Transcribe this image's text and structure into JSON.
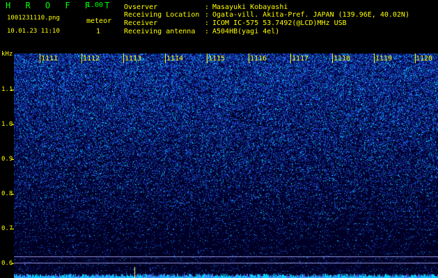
{
  "header": {
    "app_title": "H R O F F T",
    "version": "1.00",
    "file_name": "1001231110.png",
    "meteor_label": "meteor",
    "date_time": "10.01.23 11:10",
    "meteor_count": "1"
  },
  "station_info": [
    {
      "label": "Ovserver",
      "value": "Masayuki Kobayashi"
    },
    {
      "label": "Receiving Location",
      "value": "Ogata-vill. Akita-Pref. JAPAN (139.96E, 40.02N)"
    },
    {
      "label": "Receiver",
      "value": "ICOM IC-575 53.7492(@LCD)MHz USB"
    },
    {
      "label": "Receiving antenna",
      "value": "A504HB(yagi 4el)"
    }
  ],
  "colon": ":",
  "axis": {
    "y_unit_label": "kHz",
    "y_ticks": [
      "1.1",
      "1.0",
      "0.9",
      "0.8",
      "0.7",
      "0.6"
    ],
    "x_ticks": [
      "1111",
      "1112",
      "1113",
      "1114",
      "1115",
      "1116",
      "1117",
      "1118",
      "1119",
      "1120"
    ]
  },
  "colors": {
    "text": "#ffff00",
    "title": "#00ff00",
    "background": "#000000",
    "signal_low": "#000066",
    "signal_mid": "#1a2cff",
    "signal_high": "#00e5ff"
  }
}
